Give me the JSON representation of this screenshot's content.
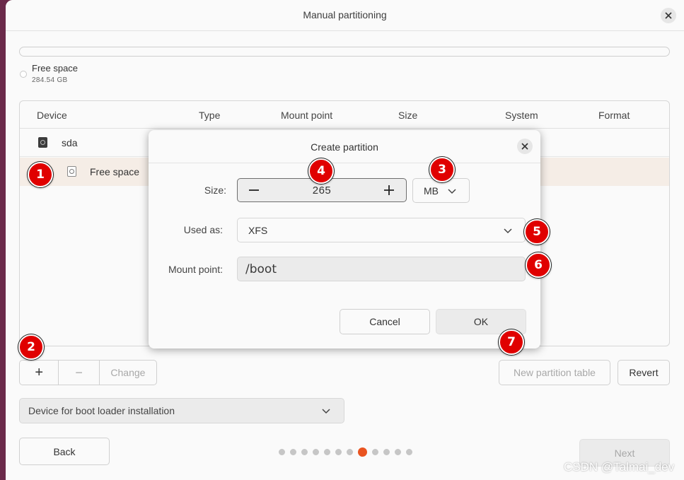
{
  "window": {
    "title": "Manual partitioning"
  },
  "storage": {
    "legend_label": "Free space",
    "legend_size": "284.54 GB"
  },
  "table": {
    "headers": [
      "Device",
      "Type",
      "Mount point",
      "Size",
      "System",
      "Format"
    ],
    "rows": [
      {
        "device": "sda",
        "icon": "disk-drive-icon"
      },
      {
        "device": "Free space",
        "icon": "partition-icon"
      }
    ]
  },
  "toolbar": {
    "add": "+",
    "remove": "−",
    "change": "Change",
    "new_table": "New partition table",
    "revert": "Revert"
  },
  "boot_loader": {
    "label": "Device for boot loader installation"
  },
  "nav": {
    "back": "Back",
    "next": "Next",
    "steps_total": 12,
    "active_step": 8
  },
  "dialog": {
    "title": "Create partition",
    "size_label": "Size:",
    "size_value": "265",
    "size_unit": "MB",
    "used_as_label": "Used as:",
    "used_as_value": "XFS",
    "mount_label": "Mount point:",
    "mount_value": "/boot",
    "cancel": "Cancel",
    "ok": "OK"
  },
  "annotations": [
    "1",
    "2",
    "3",
    "4",
    "5",
    "6",
    "7"
  ],
  "watermark": "CSDN @Talmai_dev",
  "colors": {
    "accent": "#e95420",
    "badge": "#e00000",
    "background": "#6b2a4a"
  }
}
